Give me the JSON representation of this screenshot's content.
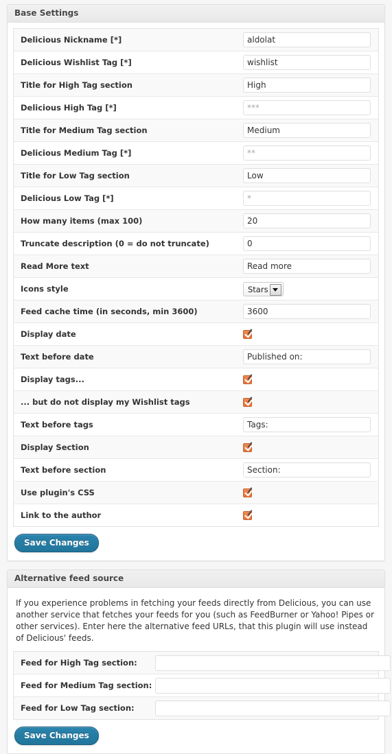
{
  "base_settings": {
    "title": "Base Settings",
    "rows": [
      {
        "label": "Delicious Nickname [*]",
        "type": "text",
        "value": "aldolat",
        "muted": false
      },
      {
        "label": "Delicious Wishlist Tag [*]",
        "type": "text",
        "value": "wishlist",
        "muted": false
      },
      {
        "label": "Title for High Tag section",
        "type": "text",
        "value": "High",
        "muted": false
      },
      {
        "label": "Delicious High Tag [*]",
        "type": "text",
        "value": "***",
        "muted": true
      },
      {
        "label": "Title for Medium Tag section",
        "type": "text",
        "value": "Medium",
        "muted": false
      },
      {
        "label": "Delicious Medium Tag [*]",
        "type": "text",
        "value": "**",
        "muted": true
      },
      {
        "label": "Title for Low Tag section",
        "type": "text",
        "value": "Low",
        "muted": false
      },
      {
        "label": "Delicious Low Tag [*]",
        "type": "text",
        "value": "*",
        "muted": true
      },
      {
        "label": "How many items (max 100)",
        "type": "text",
        "value": "20",
        "muted": false
      },
      {
        "label": "Truncate description (0 = do not truncate)",
        "type": "text",
        "value": "0",
        "muted": false
      },
      {
        "label": "Read More text",
        "type": "text",
        "value": "Read more",
        "muted": false
      },
      {
        "label": "Icons style",
        "type": "select",
        "value": "Stars"
      },
      {
        "label": "Feed cache time (in seconds, min 3600)",
        "type": "text",
        "value": "3600",
        "muted": false
      },
      {
        "label": "Display date",
        "type": "checkbox",
        "checked": true
      },
      {
        "label": "Text before date",
        "type": "text",
        "value": "Published on:",
        "muted": false
      },
      {
        "label": "Display tags...",
        "type": "checkbox",
        "checked": true
      },
      {
        "label": "... but do not display my Wishlist tags",
        "type": "checkbox",
        "checked": true
      },
      {
        "label": "Text before tags",
        "type": "text",
        "value": "Tags:",
        "muted": false
      },
      {
        "label": "Display Section",
        "type": "checkbox",
        "checked": true
      },
      {
        "label": "Text before section",
        "type": "text",
        "value": "Section:",
        "muted": false
      },
      {
        "label": "Use plugin's CSS",
        "type": "checkbox",
        "checked": true
      },
      {
        "label": "Link to the author",
        "type": "checkbox",
        "checked": true
      }
    ],
    "save_label": "Save Changes"
  },
  "alternative_feed": {
    "title": "Alternative feed source",
    "description": "If you experience problems in fetching your feeds directly from Delicious, you can use another service that fetches your feeds for you (such as FeedBurner or Yahoo! Pipes or other services). Enter here the alternative feed URLs, that this plugin will use instead of Delicious' feeds.",
    "rows": [
      {
        "label": "Feed for High Tag section:",
        "value": ""
      },
      {
        "label": "Feed for Medium Tag section:",
        "value": ""
      },
      {
        "label": "Feed for Low Tag section:",
        "value": ""
      }
    ],
    "save_label": "Save Changes"
  },
  "icons": {
    "select_arrow": "chevron-down-icon",
    "checkbox_check": "check-icon"
  },
  "colors": {
    "accent_button": "#21759b",
    "checkbox_fill": "#e8743d",
    "panel_header_bg": "#e8e8e8",
    "page_bg": "#f6f6f6"
  },
  "select_options": {
    "icons_style": [
      "Stars"
    ]
  }
}
